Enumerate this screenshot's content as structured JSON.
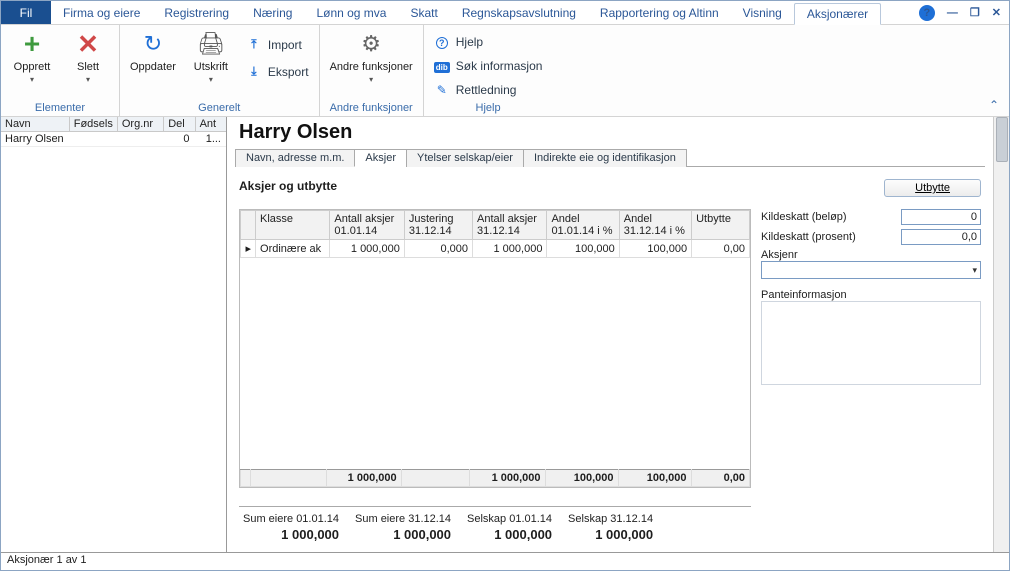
{
  "menu": {
    "file": "Fil",
    "items": [
      "Firma og eiere",
      "Registrering",
      "Næring",
      "Lønn og mva",
      "Skatt",
      "Regnskapsavslutning",
      "Rapportering og Altinn",
      "Visning",
      "Aksjonærer"
    ],
    "activeIndex": 8
  },
  "ribbon": {
    "groups": {
      "elementer": {
        "label": "Elementer",
        "opprett": "Opprett",
        "slett": "Slett"
      },
      "generelt": {
        "label": "Generelt",
        "oppdater": "Oppdater",
        "utskrift": "Utskrift",
        "import": "Import",
        "eksport": "Eksport"
      },
      "andre": {
        "label": "Andre funksjoner",
        "btn": "Andre funksjoner"
      },
      "hjelp": {
        "label": "Hjelp",
        "hjelp": "Hjelp",
        "sok": "Søk informasjon",
        "rett": "Rettledning"
      }
    }
  },
  "leftPane": {
    "headers": [
      "Navn",
      "Fødsels",
      "Org.nr",
      "Del",
      "Ant"
    ],
    "row": {
      "navn": "Harry Olsen",
      "fodsels": "",
      "orgnr": "",
      "del": "0",
      "ant": "1..."
    }
  },
  "page": {
    "title": "Harry Olsen",
    "tabs": [
      "Navn, adresse m.m.",
      "Aksjer",
      "Ytelser selskap/eier",
      "Indirekte eie og identifikasjon"
    ],
    "activeTab": 1,
    "sectionLabel": "Aksjer og utbytte",
    "utbytteBtn": "Utbytte"
  },
  "table": {
    "headers": {
      "klasse": "Klasse",
      "antall_start": "Antall aksjer 01.01.14",
      "justering": "Justering 31.12.14",
      "antall_slutt": "Antall aksjer 31.12.14",
      "andel_start": "Andel 01.01.14 i %",
      "andel_slutt": "Andel 31.12.14 i %",
      "utbytte": "Utbytte"
    },
    "row": {
      "klasse": "Ordinære ak",
      "antall_start": "1 000,000",
      "justering": "0,000",
      "antall_slutt": "1 000,000",
      "andel_start": "100,000",
      "andel_slutt": "100,000",
      "utbytte": "0,00"
    },
    "footer": {
      "antall_start": "1 000,000",
      "antall_slutt": "1 000,000",
      "andel_start": "100,000",
      "andel_slutt": "100,000",
      "utbytte": "0,00"
    }
  },
  "side": {
    "kilde_belop_label": "Kildeskatt (beløp)",
    "kilde_belop": "0",
    "kilde_prosent_label": "Kildeskatt (prosent)",
    "kilde_prosent": "0,0",
    "aksjenr_label": "Aksjenr",
    "pante_label": "Panteinformasjon"
  },
  "summary": {
    "cols": [
      {
        "label": "Sum eiere 01.01.14",
        "value": "1 000,000"
      },
      {
        "label": "Sum eiere 31.12.14",
        "value": "1 000,000"
      },
      {
        "label": "Selskap 01.01.14",
        "value": "1 000,000"
      },
      {
        "label": "Selskap 31.12.14",
        "value": "1 000,000"
      }
    ]
  },
  "status": "Aksjonær 1 av 1"
}
